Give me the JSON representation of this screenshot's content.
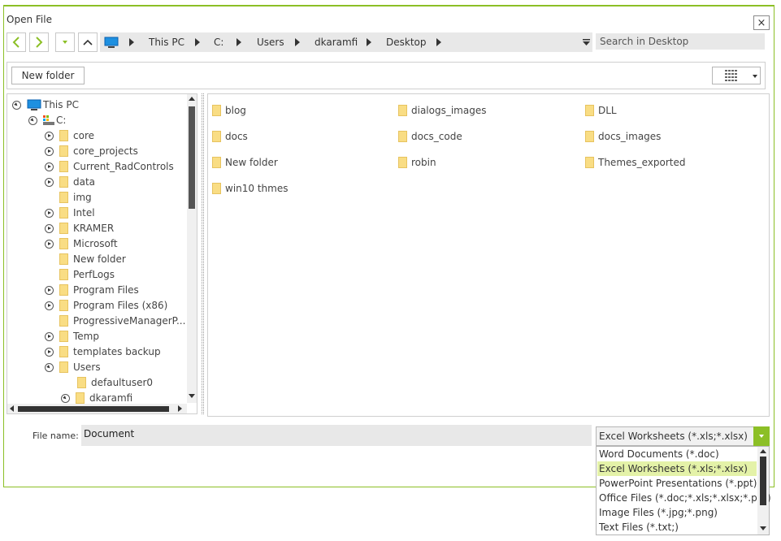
{
  "dialog": {
    "title": "Open File",
    "close_label": "×"
  },
  "nav": {
    "breadcrumbs": [
      "This PC",
      "C:",
      "Users",
      "dkaramfi",
      "Desktop"
    ],
    "search_placeholder": "Search in Desktop"
  },
  "toolbar": {
    "new_folder_label": "New folder"
  },
  "tree": {
    "items": [
      {
        "label": "This PC",
        "icon": "computer-icon"
      },
      {
        "label": "C:",
        "icon": "drive-icon"
      },
      {
        "label": "core"
      },
      {
        "label": "core_projects"
      },
      {
        "label": "Current_RadControls"
      },
      {
        "label": "data"
      },
      {
        "label": "img"
      },
      {
        "label": "Intel"
      },
      {
        "label": "KRAMER"
      },
      {
        "label": "Microsoft"
      },
      {
        "label": "New folder"
      },
      {
        "label": "PerfLogs"
      },
      {
        "label": "Program Files"
      },
      {
        "label": "Program Files (x86)"
      },
      {
        "label": "ProgressiveManagerP..."
      },
      {
        "label": "Temp"
      },
      {
        "label": "templates backup"
      },
      {
        "label": "Users"
      },
      {
        "label": "defaultuser0"
      },
      {
        "label": "dkaramfi"
      }
    ]
  },
  "files": {
    "items": [
      "blog",
      "dialogs_images",
      "DLL",
      "docs",
      "docs_code",
      "docs_images",
      "New folder",
      "robin",
      "Themes_exported",
      "win10 thmes"
    ]
  },
  "bottom": {
    "file_name_label": "File name:",
    "file_name_value": "Document",
    "filter_value": "Excel Worksheets (*.xls;*.xlsx)",
    "filter_options": [
      "Word Documents (*.doc)",
      "Excel Worksheets (*.xls;*.xlsx)",
      "PowerPoint Presentations (*.ppt)",
      "Office Files (*.doc;*.xls;*.xlsx;*.ppt)",
      "Image Files (*.jpg;*.png)",
      "Text Files (*.txt;)"
    ]
  },
  "colors": {
    "accent": "#8cbf26",
    "folder": "#f9dd84",
    "selected": "#e4f2a8"
  }
}
